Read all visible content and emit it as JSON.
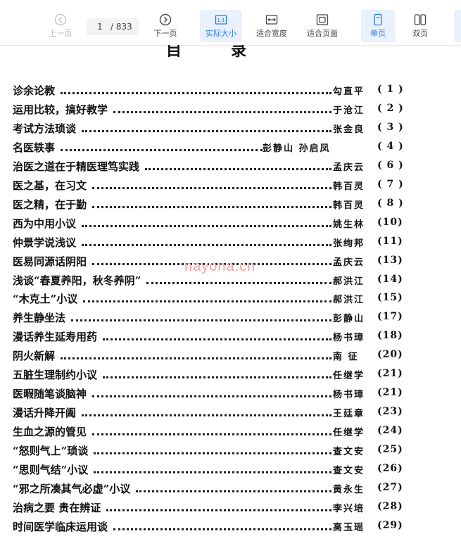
{
  "toolbar": {
    "prev_label": "上一页",
    "next_label": "下一页",
    "current_page": "1",
    "total_pages": "/ 833",
    "actual_size_label": "实际大小",
    "fit_width_label": "适合宽度",
    "fit_page_label": "适合页面",
    "single_page_label": "单页",
    "double_page_label": "双页",
    "actual_size_icon_text": "1:1"
  },
  "document": {
    "title": "目录",
    "watermark": "nayona.cn",
    "toc": [
      {
        "title": "诊余论教",
        "author": "勾直平",
        "page": "( 1 )"
      },
      {
        "title": "运用比较，搞好教学",
        "author": "于沧江",
        "page": "( 2 )"
      },
      {
        "title": "考试方法琐谈",
        "author": "张金良",
        "page": "( 3 )"
      },
      {
        "title": "名医轶事",
        "author": "彭静山  孙启凤",
        "page": "( 4 )"
      },
      {
        "title": "治医之道在于精医理笃实践",
        "author": "孟庆云",
        "page": "( 6 )"
      },
      {
        "title": "医之基，在习文",
        "author": "韩百灵",
        "page": "( 7 )"
      },
      {
        "title": "医之精，在于勤",
        "author": "韩百灵",
        "page": "( 8 )"
      },
      {
        "title": "西为中用小议",
        "author": "姚生林",
        "page": "(10)"
      },
      {
        "title": "仲景学说浅议",
        "author": "张绚邦",
        "page": "(11)"
      },
      {
        "title": "医易同源话阴阳",
        "author": "孟庆云",
        "page": "(13)"
      },
      {
        "title": "浅谈“春夏养阳，秋冬养阴”",
        "author": "郝洪江",
        "page": "(14)"
      },
      {
        "title": "“木克土”小议",
        "author": "郝洪江",
        "page": "(15)"
      },
      {
        "title": "养生静坐法",
        "author": "彭静山",
        "page": "(17)"
      },
      {
        "title": "漫话养生延寿用药",
        "author": "杨书璋",
        "page": "(18)"
      },
      {
        "title": "阴火新解",
        "author": "南  征",
        "page": "(20)"
      },
      {
        "title": "五脏生理制约小议",
        "author": "任继学",
        "page": "(21)"
      },
      {
        "title": "医暇随笔谈脑神",
        "author": "杨书璋",
        "page": "(21)"
      },
      {
        "title": "漫话升降开阖",
        "author": "王廷章",
        "page": "(23)"
      },
      {
        "title": "生血之源的管见",
        "author": "任继学",
        "page": "(24)"
      },
      {
        "title": "“怒则气上”琐谈",
        "author": "查文安",
        "page": "(25)"
      },
      {
        "title": "“思则气结”小议",
        "author": "查文安",
        "page": "(26)"
      },
      {
        "title": "“邪之所凑其气必虚”小议",
        "author": "黄永生",
        "page": "(27)"
      },
      {
        "title": "治病之要  贵在辨证",
        "author": "李兴培",
        "page": "(28)"
      },
      {
        "title": "时间医学临床运用谈",
        "author": "高玉瑶",
        "page": "(29)"
      }
    ]
  }
}
